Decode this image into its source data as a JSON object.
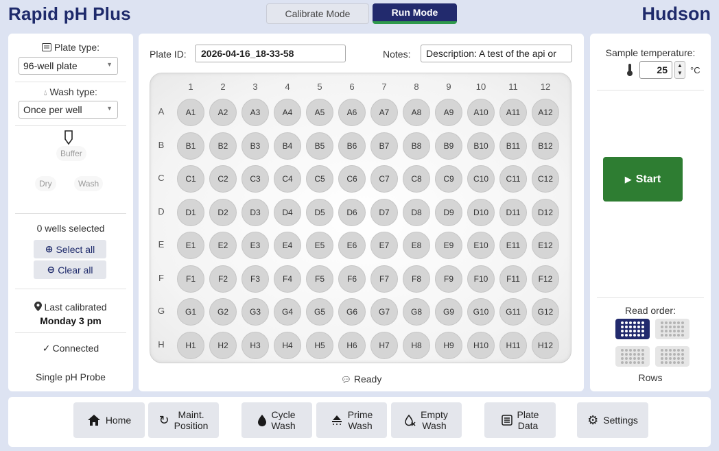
{
  "app": {
    "title": "Rapid pH Plus",
    "brand": "Hudson"
  },
  "modes": {
    "calibrate": "Calibrate Mode",
    "run": "Run Mode"
  },
  "left": {
    "plate_type_label": "Plate type:",
    "plate_type_value": "96-well plate",
    "wash_type_label": "Wash type:",
    "wash_type_value": "Once per well",
    "buffer_label": "Buffer",
    "dry_label": "Dry",
    "wash_label": "Wash",
    "wells_selected": "0 wells selected",
    "select_all": "Select all",
    "clear_all": "Clear all",
    "last_calibrated_label": "Last calibrated",
    "last_calibrated_value": "Monday 3 pm",
    "connection": "Connected",
    "probe": "Single pH Probe"
  },
  "center": {
    "plate_id_label": "Plate ID:",
    "plate_id_value": "2026-04-16_18-33-58",
    "notes_label": "Notes:",
    "notes_value": "Description: A test of the api or",
    "columns": [
      "1",
      "2",
      "3",
      "4",
      "5",
      "6",
      "7",
      "8",
      "9",
      "10",
      "11",
      "12"
    ],
    "rows": [
      "A",
      "B",
      "C",
      "D",
      "E",
      "F",
      "G",
      "H"
    ],
    "status": "Ready"
  },
  "right": {
    "temp_label": "Sample temperature:",
    "temp_value": "25",
    "temp_unit": "°C",
    "start": "Start",
    "read_order_label": "Read order:",
    "read_order_value": "Rows",
    "read_order_selected": 0
  },
  "nav": {
    "home": "Home",
    "maint_1": "Maint.",
    "maint_2": "Position",
    "cycle_1": "Cycle",
    "cycle_2": "Wash",
    "prime_1": "Prime",
    "prime_2": "Wash",
    "empty_1": "Empty",
    "empty_2": "Wash",
    "plate_1": "Plate",
    "plate_2": "Data",
    "settings": "Settings"
  },
  "icons": {
    "plate_type": "list-icon",
    "wash_type": "drop-icon",
    "location": "pin-icon",
    "check": "check-icon",
    "thermometer": "thermometer-icon",
    "chat": "chat-icon",
    "home": "home-icon",
    "maint": "redo-arrow-icon",
    "cycle": "drop-icon",
    "prime": "shower-icon",
    "empty": "empty-drop-icon",
    "plate": "list-icon",
    "settings": "gear-icon"
  },
  "colors": {
    "primary": "#222a6d",
    "accent": "#2e7d32",
    "background": "#dde3f2"
  }
}
